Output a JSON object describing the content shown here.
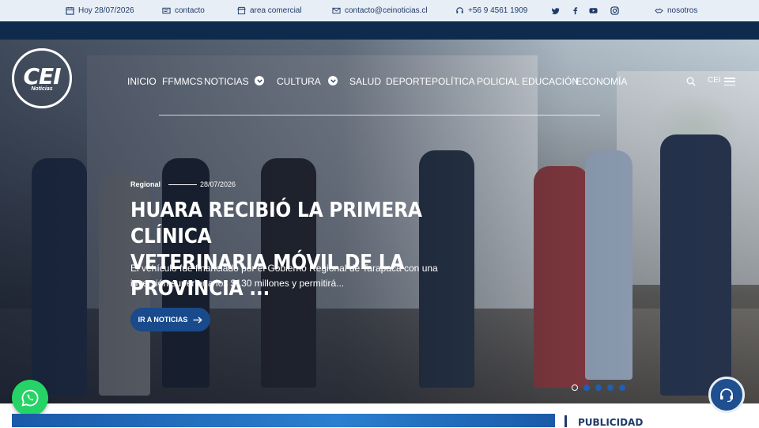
{
  "topbar": {
    "date": "Hoy 28/07/2026",
    "contact": "contacto",
    "commercial": "area comercial",
    "email": "contacto@ceinoticias.cl",
    "phone": "+56 9 4561 1909",
    "us": "nosotros",
    "social": [
      "twitter-icon",
      "facebook-icon",
      "youtube-icon",
      "instagram-icon"
    ]
  },
  "logo": {
    "main": "CEI",
    "sub": "Noticias"
  },
  "nav": {
    "items": [
      "INICIO",
      "FFMMCS",
      "NOTICIAS",
      "CULTURA",
      "SALUD",
      "DEPORTE",
      "POLÍTICA",
      "POLICIAL",
      "EDUCACIÓN",
      "ECONOMÍA"
    ],
    "cei": "CEI"
  },
  "hero": {
    "category": "Regional",
    "date": "28/07/2026",
    "headline_1": "HUARA RECIBIÓ LA PRIMERA CLÍNICA",
    "headline_2": "VETERINARIA MÓVIL DE LA PROVINCIA ...",
    "excerpt": "El vehículo fue financiado por el Gobierno Regional de Tarapacá con una inversión superior a los $130 millones y permitirá...",
    "cta": "IR A NOTICIAS",
    "slides": 5,
    "active_slide": 1
  },
  "sidebar": {
    "title": "PUBLICIDAD"
  },
  "colors": {
    "topbar": "#e8eef6",
    "navy": "#0e2a4c",
    "accent": "#184a8c",
    "whatsapp": "#25d366"
  }
}
